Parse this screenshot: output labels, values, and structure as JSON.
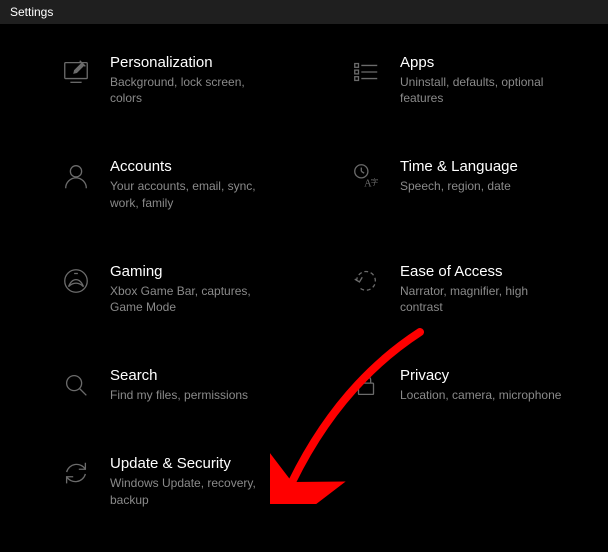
{
  "window": {
    "title": "Settings"
  },
  "tiles": [
    {
      "title": "Personalization",
      "desc": "Background, lock screen, colors"
    },
    {
      "title": "Apps",
      "desc": "Uninstall, defaults, optional features"
    },
    {
      "title": "Accounts",
      "desc": "Your accounts, email, sync, work, family"
    },
    {
      "title": "Time & Language",
      "desc": "Speech, region, date"
    },
    {
      "title": "Gaming",
      "desc": "Xbox Game Bar, captures, Game Mode"
    },
    {
      "title": "Ease of Access",
      "desc": "Narrator, magnifier, high contrast"
    },
    {
      "title": "Search",
      "desc": "Find my files, permissions"
    },
    {
      "title": "Privacy",
      "desc": "Location, camera, microphone"
    },
    {
      "title": "Update & Security",
      "desc": "Windows Update, recovery, backup"
    }
  ]
}
